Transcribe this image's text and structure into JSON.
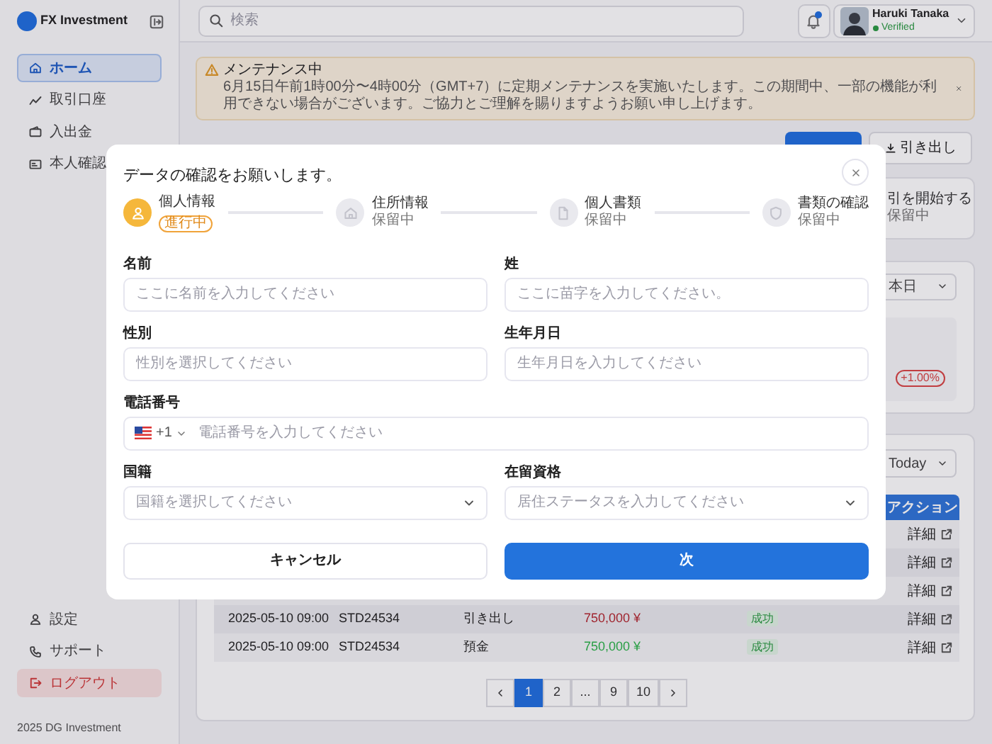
{
  "sidebar": {
    "brand": "FX Investment",
    "nav": [
      {
        "label": "ホーム",
        "selected": true
      },
      {
        "label": "取引口座",
        "selected": false
      },
      {
        "label": "入出金",
        "selected": false
      },
      {
        "label": "本人確認",
        "selected": false
      }
    ],
    "bottom": [
      {
        "label": "設定",
        "kind": "normal"
      },
      {
        "label": "サポート",
        "kind": "normal"
      },
      {
        "label": "ログアウト",
        "kind": "danger"
      }
    ],
    "footer": "2025 DG Investment"
  },
  "topbar": {
    "search": {
      "placeholder": "検索"
    },
    "notification_dot": true,
    "user": {
      "name": "Haruki Tanaka",
      "status": "Verified"
    }
  },
  "alert": {
    "title": "メンテナンス中",
    "message": "6月15日午前1時00分〜4時00分（GMT+7）に定期メンテナンスを実施いたします。この期間中、一部の機能が利用できない場合がございます。ご協力とご理解を賜りますようお願い申し上げます。"
  },
  "actions": [
    {
      "kind": "primary"
    },
    {
      "label": "引き出し",
      "kind": "secondary"
    }
  ],
  "step_card": {
    "title": "引を開始する",
    "status": "保留中"
  },
  "summary_card": {
    "period": "本日",
    "change": "+1.00%"
  },
  "transactions": {
    "period": "Today",
    "action_header": "アクション",
    "rows": [
      {
        "action": "詳細"
      },
      {
        "action": "詳細"
      },
      {
        "action": "詳細"
      },
      {
        "date": "2025-05-10 09:00",
        "id": "STD24534",
        "type": "引き出し",
        "amount": "750,000 ¥",
        "kind": "withdrawal",
        "status": "成功",
        "action": "詳細"
      },
      {
        "date": "2025-05-10 09:00",
        "id": "STD24534",
        "type": "預金",
        "amount": "750,000 ¥",
        "kind": "deposit",
        "status": "成功",
        "action": "詳細"
      }
    ],
    "pagination": [
      {
        "label": "1",
        "selected": true
      },
      {
        "label": "2",
        "selected": false
      },
      {
        "label": "...",
        "selected": false
      },
      {
        "label": "9",
        "selected": false
      },
      {
        "label": "10",
        "selected": false
      }
    ]
  },
  "modal": {
    "title": "データの確認をお願いします。",
    "steps": [
      {
        "label": "個人情報",
        "status": "進行中",
        "active": true
      },
      {
        "label": "住所情報",
        "status": "保留中",
        "active": false
      },
      {
        "label": "個人書類",
        "status": "保留中",
        "active": false
      },
      {
        "label": "書類の確認",
        "status": "保留中",
        "active": false
      }
    ],
    "fields": [
      {
        "kind": "text",
        "label": "名前",
        "placeholder": "ここに名前を入力してください"
      },
      {
        "kind": "text",
        "label": "姓",
        "placeholder": "ここに苗字を入力してください。"
      },
      {
        "kind": "text",
        "label": "性別",
        "placeholder": "性別を選択してください"
      },
      {
        "kind": "text",
        "label": "生年月日",
        "placeholder": "生年月日を入力してください"
      },
      {
        "kind": "phone",
        "label": "電話番号",
        "country_code": "+1",
        "placeholder": "電話番号を入力してください"
      },
      {
        "kind": "select",
        "label": "国籍",
        "placeholder": "国籍を選択してください"
      },
      {
        "kind": "select",
        "label": "在留資格",
        "placeholder": "居住ステータスを入力してください"
      }
    ],
    "buttons": [
      {
        "label": "キャンセル",
        "kind": "secondary"
      },
      {
        "label": "次",
        "kind": "primary"
      }
    ]
  }
}
